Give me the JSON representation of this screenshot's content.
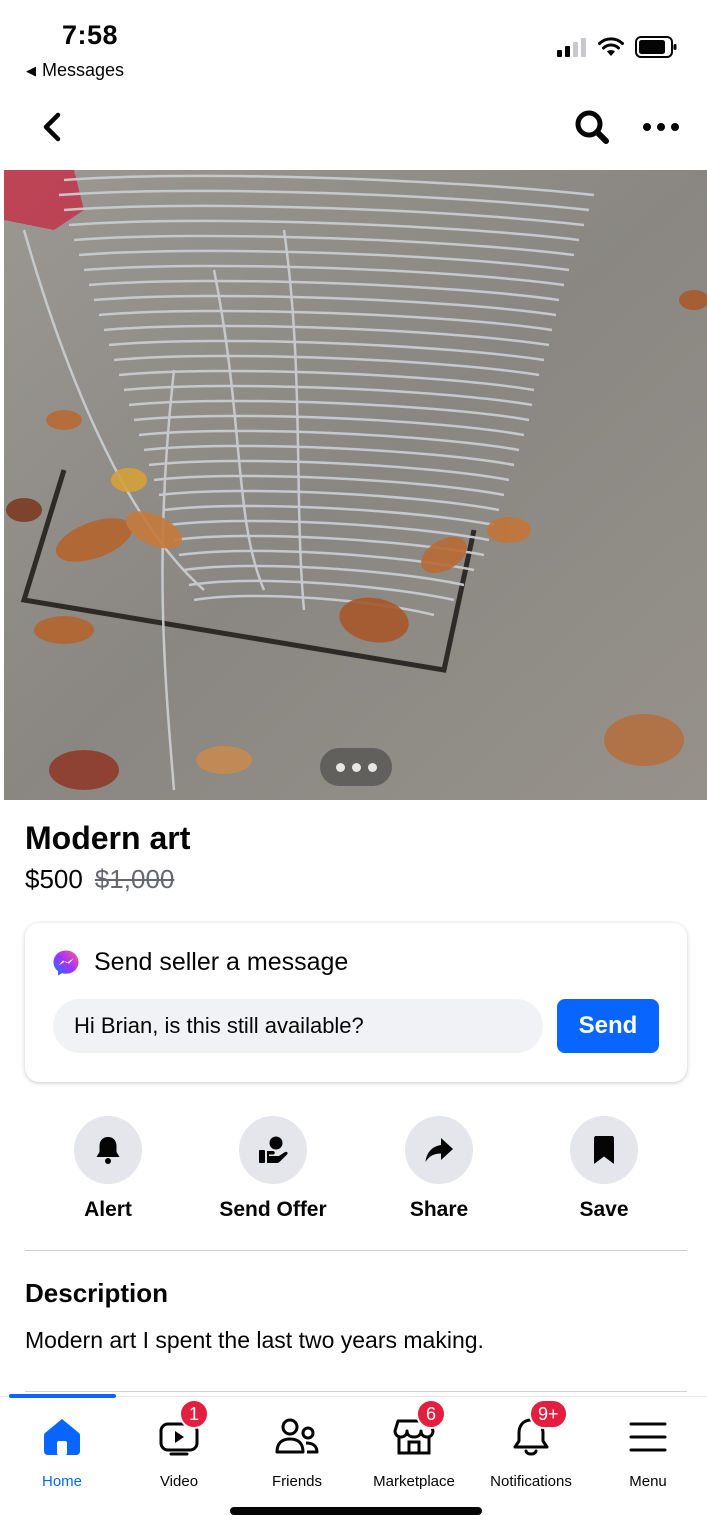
{
  "status_bar": {
    "time": "7:58",
    "back_app": "Messages",
    "icons": [
      "signal-icon",
      "wifi-icon",
      "battery-icon"
    ]
  },
  "nav": {
    "icons": [
      "chevron-left-icon",
      "search-icon",
      "more-icon"
    ]
  },
  "listing": {
    "title": "Modern art",
    "price": "$500",
    "original_price": "$1,000"
  },
  "message": {
    "header": "Send seller a message",
    "input_value": "Hi Brian, is this still available?",
    "send_label": "Send"
  },
  "actions": [
    {
      "label": "Alert",
      "icon": "bell-icon"
    },
    {
      "label": "Send Offer",
      "icon": "offer-icon"
    },
    {
      "label": "Share",
      "icon": "share-arrow-icon"
    },
    {
      "label": "Save",
      "icon": "bookmark-icon"
    }
  ],
  "description": {
    "heading": "Description",
    "text": "Modern art I spent the last two years making."
  },
  "tabbar": {
    "tabs": [
      {
        "label": "Home",
        "icon": "home-icon",
        "active": true,
        "badge": ""
      },
      {
        "label": "Video",
        "icon": "video-icon",
        "active": false,
        "badge": "1"
      },
      {
        "label": "Friends",
        "icon": "friends-icon",
        "active": false,
        "badge": ""
      },
      {
        "label": "Marketplace",
        "icon": "marketplace-icon",
        "active": false,
        "badge": "6"
      },
      {
        "label": "Notifications",
        "icon": "bell-icon",
        "active": false,
        "badge": "9+"
      },
      {
        "label": "Menu",
        "icon": "menu-icon",
        "active": false,
        "badge": ""
      }
    ]
  },
  "colors": {
    "accent": "#0866ff",
    "badge": "#e41e3f",
    "button_bg": "#e4e6eb",
    "muted_text": "#65676b"
  }
}
